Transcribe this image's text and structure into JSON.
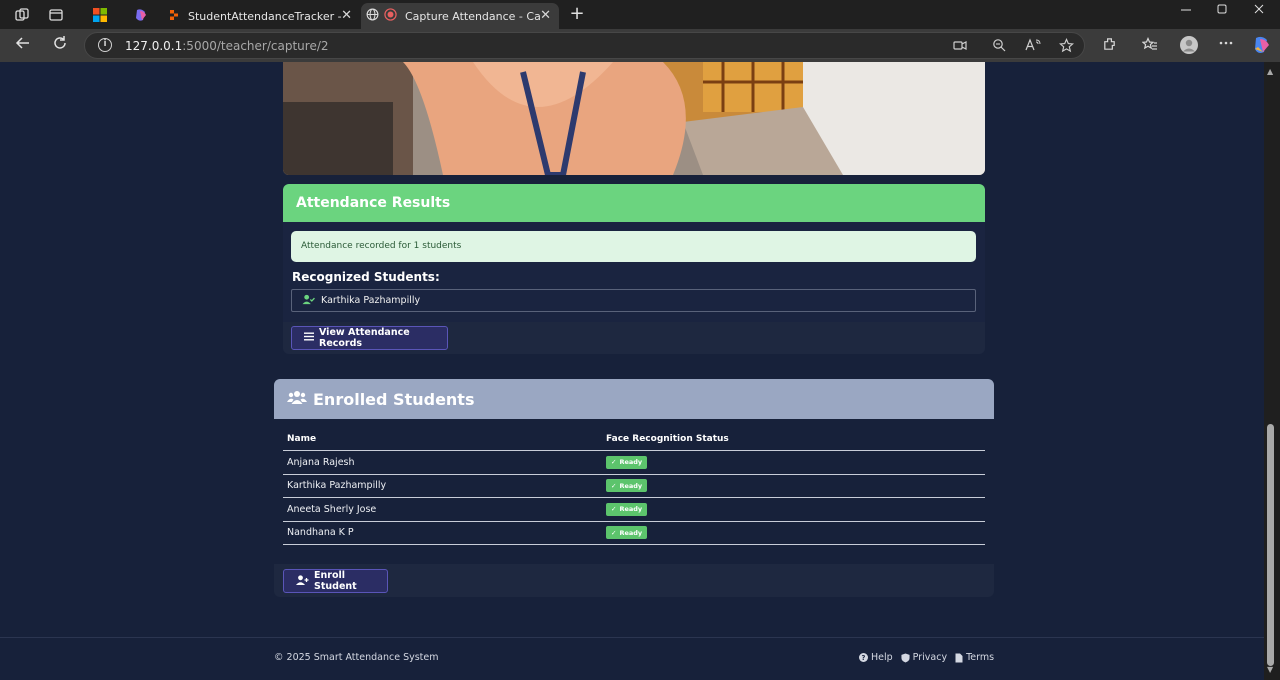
{
  "browser": {
    "tabs": [
      {
        "title": "StudentAttendanceTracker - Repli",
        "icon": "replit-icon",
        "active": false
      },
      {
        "title": "Capture Attendance - Captu",
        "icon": "recording-icon",
        "active": true
      }
    ],
    "new_tab_symbol": "+",
    "close_symbol": "✕",
    "url_host": "127.0.0.1",
    "url_path": ":5000/teacher/capture/2"
  },
  "results": {
    "heading": "Attendance Results",
    "alert": "Attendance recorded for 1 students",
    "recognized_title": "Recognized Students:",
    "recognized": [
      "Karthika Pazhampilly"
    ],
    "view_button": "View Attendance Records"
  },
  "enrolled": {
    "heading": "Enrolled Students",
    "columns": [
      "Name",
      "Face Recognition Status"
    ],
    "rows": [
      {
        "name": "Anjana Rajesh",
        "status": "Ready"
      },
      {
        "name": "Karthika Pazhampilly",
        "status": "Ready"
      },
      {
        "name": "Aneeta Sherly Jose",
        "status": "Ready"
      },
      {
        "name": "Nandhana K P",
        "status": "Ready"
      }
    ],
    "enroll_button": "Enroll Student"
  },
  "footer": {
    "copyright": "© 2025 Smart Attendance System",
    "links": [
      "Help",
      "Privacy",
      "Terms"
    ]
  },
  "colors": {
    "page_bg": "#17213a",
    "success": "#6bd47f",
    "enrolled_header": "#9aa7c2",
    "button_bg": "#2b2d64"
  }
}
